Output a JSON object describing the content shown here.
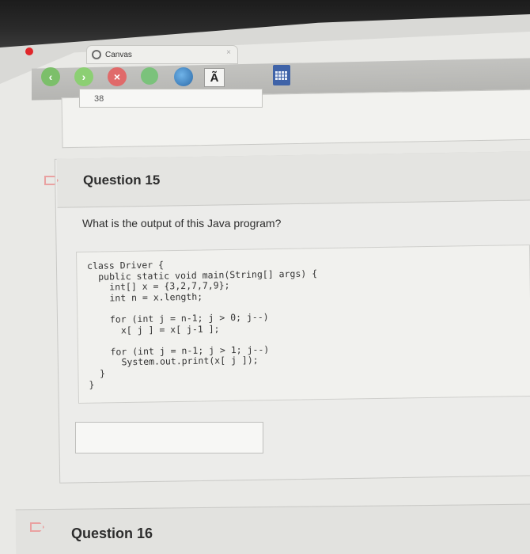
{
  "browser": {
    "tab_title": "Canvas",
    "tab_close_glyph": "×",
    "toolbar_text_glyph": "Ã",
    "icons": [
      "back-icon",
      "forward-icon",
      "stop-icon",
      "refresh-icon",
      "globe-icon",
      "text-icon",
      "calculator-icon"
    ]
  },
  "previous_question": {
    "answer_value": "38"
  },
  "question_15": {
    "title": "Question 15",
    "prompt": "What is the output of this Java program?",
    "code": "class Driver {\n  public static void main(String[] args) {\n    int[] x = {3,2,7,7,9};\n    int n = x.length;\n\n    for (int j = n-1; j > 0; j--)\n      x[ j ] = x[ j-1 ];\n\n    for (int j = n-1; j > 1; j--)\n      System.out.print(x[ j ]);\n  }\n}",
    "answer_value": ""
  },
  "question_16": {
    "title": "Question 16"
  },
  "colors": {
    "record": "#e0262a",
    "flag": "#e9a1a1",
    "back": "#7cbf6a",
    "stop": "#e06a6a"
  }
}
